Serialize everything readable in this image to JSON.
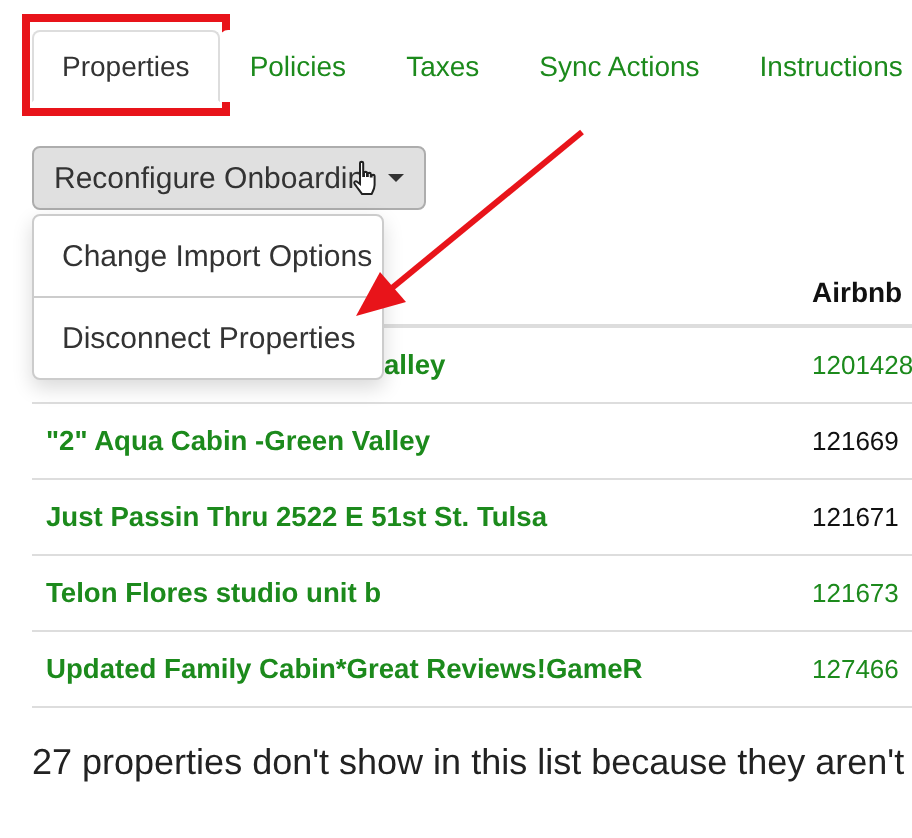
{
  "tabs": [
    {
      "label": "Properties",
      "selected": true,
      "highlighted": true
    },
    {
      "label": "Policies",
      "selected": false,
      "highlighted": false
    },
    {
      "label": "Taxes",
      "selected": false,
      "highlighted": false
    },
    {
      "label": "Sync Actions",
      "selected": false,
      "highlighted": false
    },
    {
      "label": "Instructions",
      "selected": false,
      "highlighted": false
    }
  ],
  "dropdown": {
    "label": "Reconfigure Onboardin",
    "expanded": true,
    "items": [
      {
        "label": "Change Import Options"
      },
      {
        "label": "Disconnect Properties"
      }
    ]
  },
  "annotations": {
    "arrow": true
  },
  "table": {
    "columns": [
      "Airbnb"
    ],
    "rows": [
      {
        "name": "alley",
        "id": "1201428",
        "id_linked": true
      },
      {
        "name": "\"2\" Aqua Cabin -Green Valley",
        "id": "121669",
        "id_linked": false
      },
      {
        "name": "Just Passin Thru 2522 E 51st St. Tulsa",
        "id": "121671",
        "id_linked": false
      },
      {
        "name": "Telon Flores studio unit b",
        "id": "121673",
        "id_linked": true
      },
      {
        "name": "Updated Family Cabin*Great Reviews!GameR",
        "id": "127466",
        "id_linked": true
      }
    ]
  },
  "footer": "27 properties don't show in this list because they aren't"
}
